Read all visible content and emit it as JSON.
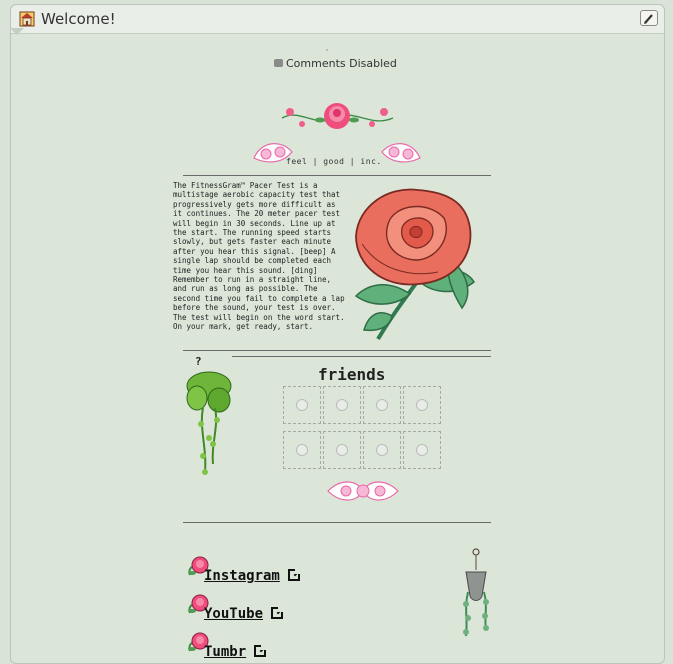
{
  "window": {
    "title": "Welcome!"
  },
  "comments": {
    "text": "Comments Disabled"
  },
  "brand": {
    "text": "feel | good | inc."
  },
  "pacer_text": "The FitnessGram™ Pacer Test is a multistage aerobic capacity test that progressively gets more difficult as it continues. The 20 meter pacer test will begin in 30 seconds. Line up at the start. The running speed starts slowly, but gets faster each minute after you hear this signal. [beep] A single lap should be completed each time you hear this sound. [ding] Remember to run in a straight line, and run as long as possible. The second time you fail to complete a lap before the sound, your test is over. The test will begin on the word start. On your mark, get ready, start.",
  "mystery": {
    "label": "?"
  },
  "friends": {
    "title": "friends",
    "count": 8
  },
  "links": [
    {
      "label": "Instagram"
    },
    {
      "label": "YouTube"
    },
    {
      "label": "Tumbr"
    }
  ],
  "icons": {
    "home": "home-icon",
    "edit": "pencil-icon",
    "comment": "speech-bubble-icon",
    "external": "external-link-icon"
  },
  "colors": {
    "background": "#dbe6d9",
    "header": "#e9efe8",
    "rose": "#e8705f",
    "pink": "#f0a0c0",
    "leaf": "#5aa06a"
  }
}
